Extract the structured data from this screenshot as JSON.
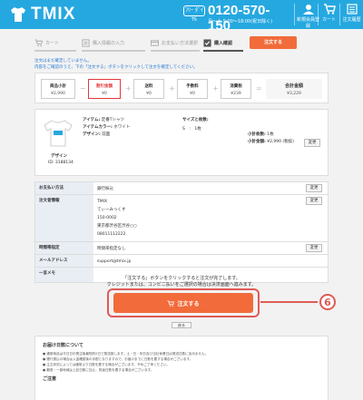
{
  "header": {
    "logo_text": "TMIX",
    "phone_badge": "ﾌﾘｰ ﾀﾞｲﾔﾙ",
    "phone_number": "0120-570-150",
    "phone_hours": "月〜土 9:00〜18:00(祝日除く)",
    "nav": [
      {
        "label": "新規会員登録",
        "icon": "user-icon"
      },
      {
        "label": "カート",
        "icon": "cart-icon"
      },
      {
        "label": "注文履歴",
        "icon": "list-icon"
      }
    ]
  },
  "steps": [
    {
      "label": "カート",
      "icon": "cart-icon"
    },
    {
      "label": "購入情報の入力",
      "icon": "form-icon"
    },
    {
      "label": "お支払い方法選択",
      "icon": "card-icon"
    },
    {
      "label": "購入確認",
      "icon": "check-icon"
    }
  ],
  "order_button_label": "注文する",
  "notice_lines": [
    "注文はまだ確定していません。",
    "内容をご確認のうえ、下の「注文する」ボタンをクリックして注文を確定してください。"
  ],
  "summary": {
    "items": [
      {
        "label": "商品小計",
        "value": "¥2,990"
      },
      {
        "label": "割引金額",
        "value": "¥0"
      },
      {
        "label": "送料",
        "value": "¥0"
      },
      {
        "label": "手数料",
        "value": "¥0"
      },
      {
        "label": "消費税",
        "value": "¥239"
      },
      {
        "label": "合計金額",
        "value": "¥3,229"
      }
    ],
    "ops": [
      "−",
      "+",
      "+",
      "+",
      "="
    ]
  },
  "item": {
    "design_label": "デザイン",
    "design_id": "ID: 3188134",
    "attrs": [
      {
        "key": "アイテム:",
        "value": "定番Tシャツ"
      },
      {
        "key": "アイテムカラー:",
        "value": "ホワイト"
      },
      {
        "key": "デザイン:",
        "value": "前面"
      }
    ],
    "size_title": "サイズと枚数:",
    "size_row": "S　:　1枚",
    "subtotals": [
      {
        "key": "小計枚数:",
        "value": "1枚"
      },
      {
        "key": "小計金額:",
        "value": "¥2,990 (税抜)"
      }
    ],
    "change_label": "変更"
  },
  "info": {
    "rows": [
      {
        "label": "お支払い方法",
        "lines": [
          "銀行振込"
        ],
        "has_change": true
      },
      {
        "label": "注文者情報",
        "lines": [
          "TMIX",
          "てぃーみっくす",
          "150-0002",
          "東京都渋谷区渋谷○○",
          "08011112222"
        ],
        "has_change": true
      },
      {
        "label": "時間帯指定",
        "lines": [
          "時間帯指定なし"
        ],
        "has_change": true
      },
      {
        "label": "メールアドレス",
        "lines": [
          "support@tmix.jp"
        ],
        "has_change": false
      },
      {
        "label": "一言メモ",
        "lines": [
          ""
        ],
        "has_change": false
      }
    ],
    "change_label": "変更"
  },
  "confirm": {
    "line1": "「注文する」ボタンをクリックすると注文が完了します。",
    "line2": "クレジットまたは、コンビニ払いをご選択の場合は決済画面へ進みます。",
    "button_label": "注文する",
    "back_label": "戻る",
    "step_number": "6"
  },
  "notes": {
    "title": "お届け日数について",
    "lines": [
      "● 通常商品は平日日中受注後最短約5日で発送致します。土・日・祝日及び当社休業日は発送日数に含みません。",
      "● 銀行振込の場合は入金確認後の手配となりますので、お届けまでに日数を要する場合がございます。",
      "● 注文状況によっては通常より日数を要する場合がございます。予めご了承ください。",
      "● 離島・一部地域は上記日数に加え、別途日数を要する場合がございます。"
    ],
    "caution": "ご注意"
  },
  "colors": {
    "header": "#25a8e0",
    "accent": "#f26b3a",
    "highlight": "#e05a55"
  }
}
